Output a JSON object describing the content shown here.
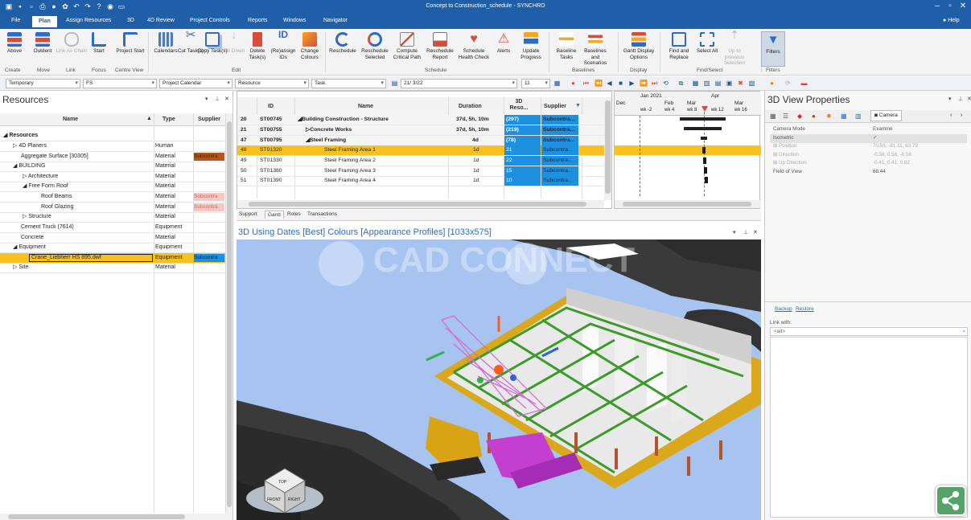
{
  "window": {
    "title": "Concept to Construction_schedule - SYNCHRO"
  },
  "menu": {
    "tabs": [
      "File",
      "Plan",
      "Assign Resources",
      "3D",
      "4D Review",
      "Project Controls",
      "Reports",
      "Windows",
      "Navigator"
    ],
    "help": "Help"
  },
  "ribbon": {
    "buttons": [
      {
        "label": "Above",
        "icon": "above-icon"
      },
      {
        "label": "Outdent",
        "icon": "outdent-icon"
      },
      {
        "label": "Link As Chain",
        "icon": "link-chain-icon"
      },
      {
        "label": "Start",
        "icon": "start-icon"
      },
      {
        "label": "Project Start",
        "icon": "project-start-icon"
      },
      {
        "label": "Calendars",
        "icon": "calendar-icon"
      },
      {
        "label": "Cut Task(s)",
        "icon": "cut-icon"
      },
      {
        "label": "Copy Task(s)",
        "icon": "copy-icon"
      },
      {
        "label": "Fill Down",
        "icon": "fill-down-icon"
      },
      {
        "label": "Delete Task(s)",
        "icon": "delete-icon"
      },
      {
        "label": "(Re)assign IDs",
        "icon": "assign-ids-icon"
      },
      {
        "label": "Change Colours",
        "icon": "change-colours-icon"
      },
      {
        "label": "Reschedule",
        "icon": "reschedule-icon"
      },
      {
        "label": "Reschedule Selected",
        "icon": "reschedule-selected-icon"
      },
      {
        "label": "Compute Critical Path",
        "icon": "critical-path-icon"
      },
      {
        "label": "Reschedule Report",
        "icon": "report-icon"
      },
      {
        "label": "Schedule Health Check",
        "icon": "health-check-icon"
      },
      {
        "label": "Alerts",
        "icon": "alert-icon"
      },
      {
        "label": "Update Progress",
        "icon": "update-progress-icon"
      },
      {
        "label": "Baseline Tasks",
        "icon": "baseline-tasks-icon"
      },
      {
        "label": "Baselines and Scenarios",
        "icon": "baselines-scenarios-icon"
      },
      {
        "label": "Gantt Display Options",
        "icon": "gantt-options-icon"
      },
      {
        "label": "Find and Replace",
        "icon": "find-replace-icon"
      },
      {
        "label": "Select All",
        "icon": "select-all-icon"
      },
      {
        "label": "Up to previous Selection",
        "icon": "up-selection-icon"
      },
      {
        "label": "Filters",
        "icon": "filter-icon"
      }
    ],
    "groups": [
      "Create",
      "Move",
      "Link",
      "Focus",
      "Centre View",
      "Edit",
      "Schedule",
      "Baselines",
      "Display",
      "Find/Select",
      "Filters"
    ]
  },
  "toolbar": {
    "combo1": "Temporary",
    "combo2": "FS",
    "combo3": "Project Calendar",
    "combo4": "Resource",
    "combo5": "Task",
    "date": "21/ 3/22",
    "duration": "11"
  },
  "resources": {
    "title": "Resources",
    "columns": [
      "Name",
      "Type",
      "Supplier"
    ],
    "rows": [
      {
        "name": "Resources",
        "type": "",
        "supplier": ""
      },
      {
        "name": "4D Planers",
        "type": "Human",
        "supplier": ""
      },
      {
        "name": "Aggregate Surface [30305]",
        "type": "Material",
        "supplier": "Subcontra"
      },
      {
        "name": "BUILDING",
        "type": "Material",
        "supplier": ""
      },
      {
        "name": "Architecture",
        "type": "Material",
        "supplier": ""
      },
      {
        "name": "Free Form Roof",
        "type": "Material",
        "supplier": ""
      },
      {
        "name": "Roof Beams",
        "type": "Material",
        "supplier": "Subcontra"
      },
      {
        "name": "Roof Glazing",
        "type": "Material",
        "supplier": "Subcontra"
      },
      {
        "name": "Structure",
        "type": "Material",
        "supplier": ""
      },
      {
        "name": "Cement Truck (7614)",
        "type": "Equipment",
        "supplier": ""
      },
      {
        "name": "Concrete",
        "type": "Material",
        "supplier": ""
      },
      {
        "name": "Equipment",
        "type": "Equipment",
        "supplier": ""
      },
      {
        "name": "Crane_Liebherr HS 895.dwf",
        "type": "Equipment",
        "supplier": "Subcontra"
      },
      {
        "name": "Site",
        "type": "Material",
        "supplier": ""
      }
    ]
  },
  "tasks": {
    "columns": [
      "ID",
      "Name",
      "Duration",
      "3D Reso...",
      "Supplier"
    ],
    "rows": [
      {
        "n": "20",
        "id": "ST00745",
        "name": "Building Construction - Structure",
        "duration": "37d, 5h, 10m",
        "res": "(297)",
        "supplier": "Subcontra..."
      },
      {
        "n": "21",
        "id": "ST00755",
        "name": "Concrete Works",
        "duration": "37d, 5h, 10m",
        "res": "(219)",
        "supplier": "Subcontra..."
      },
      {
        "n": "47",
        "id": "ST00795",
        "name": "Steel Framing",
        "duration": "4d",
        "res": "(78)",
        "supplier": "Subcontra..."
      },
      {
        "n": "48",
        "id": "ST01320",
        "name": "Steel Framing Area 1",
        "duration": "1d",
        "res": "21",
        "supplier": "Subcontra..."
      },
      {
        "n": "49",
        "id": "ST01330",
        "name": "Steel Framing Area 2",
        "duration": "1d",
        "res": "22",
        "supplier": "Subcontra..."
      },
      {
        "n": "50",
        "id": "ST01380",
        "name": "Steel Framing Area 3",
        "duration": "1d",
        "res": "15",
        "supplier": "Subcontra..."
      },
      {
        "n": "51",
        "id": "ST01390",
        "name": "Steel Framing Area 4",
        "duration": "1d",
        "res": "10",
        "supplier": "Subcontra..."
      }
    ]
  },
  "gantt": {
    "years": [
      "Jan 2021",
      "Apr"
    ],
    "months": [
      "Dec",
      "Feb",
      "Mar",
      "Mar"
    ],
    "weeks": [
      "wk -2",
      "wk 4",
      "wk 8",
      "wk 12",
      "wk 16"
    ]
  },
  "bottom_tabs": [
    "Support",
    "Gantt",
    "Roles",
    "Transactions"
  ],
  "view3d": {
    "title": "3D Using Dates [Best] Colours [Appearance Profiles]  [1033x575]",
    "watermark": "CAD CONNECT",
    "cube_faces": [
      "TOP",
      "FRONT",
      "RIGHT"
    ]
  },
  "props": {
    "title": "3D View Properties",
    "camera_tab": "Camera",
    "rows": [
      {
        "k": "Camera Mode",
        "v": "Examine"
      },
      {
        "k": "Isometric",
        "v": "✓"
      },
      {
        "k": "Position",
        "v": "70.53, -61.11, 63.79"
      },
      {
        "k": "Direction",
        "v": "-0.58, 0.58, -0.58"
      },
      {
        "k": "Up Direction",
        "v": "-0.41, 0.41, 0.82"
      },
      {
        "k": "Field of View",
        "v": "68.44"
      }
    ],
    "backup": "Backup",
    "restore": "Restore",
    "link_with": "Link with:",
    "link_value": "<all>"
  },
  "colors": {
    "titlebar": "#1f5fa8",
    "selection": "#f7c21f",
    "resource_cell": "#1e90e0"
  }
}
